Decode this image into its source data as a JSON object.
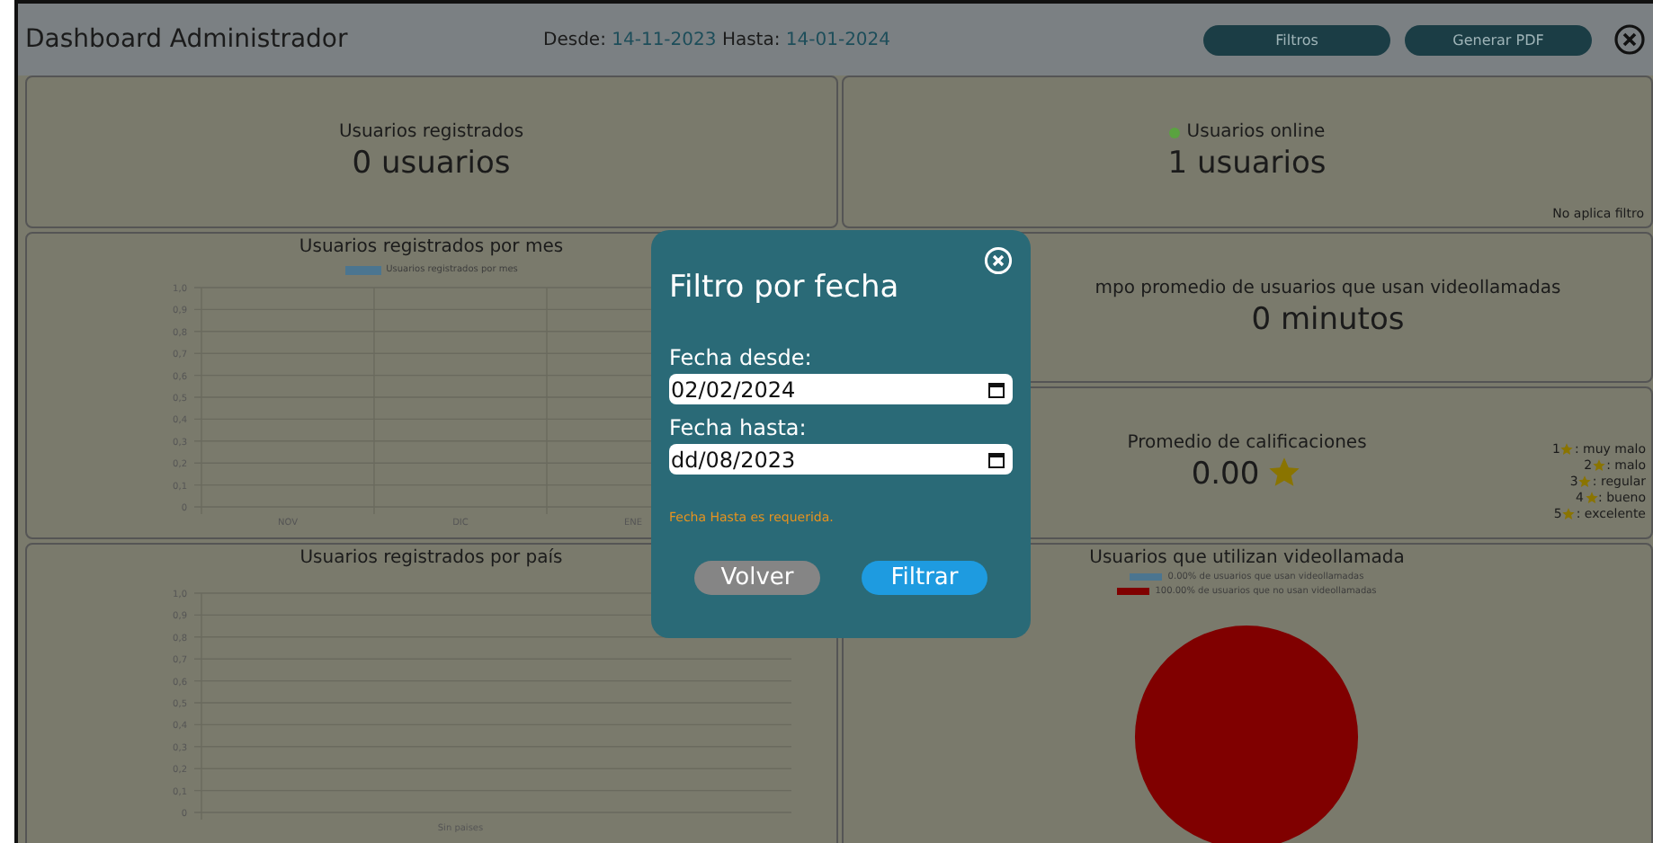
{
  "header": {
    "title": "Dashboard Administrador",
    "from_label": "Desde:",
    "from_date": "14-11-2023",
    "to_label": "Hasta:",
    "to_date": "14-01-2024",
    "buttons": [
      "Filtros",
      "Generar PDF"
    ]
  },
  "cards": {
    "registered": {
      "title": "Usuarios registrados",
      "value": "0 usuarios"
    },
    "online": {
      "title": "Usuarios online",
      "value": "1 usuarios",
      "note": "No aplica filtro"
    },
    "avg_time": {
      "title": "mpo promedio de usuarios que usan videollamadas",
      "value": "0 minutos"
    },
    "rating": {
      "title": "Promedio de calificaciones",
      "value": "0.00",
      "legend": [
        {
          "number": "1",
          "label": ": muy malo"
        },
        {
          "number": "2",
          "label": ": malo"
        },
        {
          "number": "3",
          "label": ": regular"
        },
        {
          "number": "4",
          "label": ": bueno"
        },
        {
          "number": "5",
          "label": ": excelente"
        }
      ]
    }
  },
  "month_chart": {
    "chart_data": {
      "type": "bar",
      "title": "Usuarios registrados por mes",
      "categories": [
        "NOV",
        "DIC",
        "ENE"
      ],
      "grid": true,
      "series": [
        {
          "name": "Usuarios registrados por mes",
          "color": "#4b7590",
          "values": [
            0,
            0,
            0
          ]
        }
      ],
      "ylim": [
        0,
        1
      ],
      "yticks": [
        {
          "value": 0,
          "label": "0"
        },
        {
          "value": 0.1,
          "label": "0,1"
        },
        {
          "value": 0.2,
          "label": "0,2"
        },
        {
          "value": 0.3,
          "label": "0,3"
        },
        {
          "value": 0.4,
          "label": "0,4"
        },
        {
          "value": 0.5,
          "label": "0,5"
        },
        {
          "value": 0.6,
          "label": "0,6"
        },
        {
          "value": 0.7,
          "label": "0,7"
        },
        {
          "value": 0.8,
          "label": "0,8"
        },
        {
          "value": 0.9,
          "label": "0,9"
        },
        {
          "value": 1,
          "label": "1,0"
        }
      ]
    }
  },
  "country_chart": {
    "chart_data": {
      "type": "bar",
      "title": "Usuarios registrados por país",
      "categories": [
        "Sin paises"
      ],
      "series": [
        {
          "values": [
            0
          ]
        }
      ],
      "grid": true,
      "ylim": [
        0,
        1
      ],
      "yticks": [
        {
          "value": 0,
          "label": "0"
        },
        {
          "value": 0.1,
          "label": "0,1"
        },
        {
          "value": 0.2,
          "label": "0,2"
        },
        {
          "value": 0.3,
          "label": "0,3"
        },
        {
          "value": 0.4,
          "label": "0,4"
        },
        {
          "value": 0.5,
          "label": "0,5"
        },
        {
          "value": 0.6,
          "label": "0,6"
        },
        {
          "value": 0.7,
          "label": "0,7"
        },
        {
          "value": 0.8,
          "label": "0,8"
        },
        {
          "value": 0.9,
          "label": "0,9"
        },
        {
          "value": 1,
          "label": "1,0"
        }
      ]
    }
  },
  "video_chart": {
    "chart_data": {
      "type": "pie",
      "title": "Usuarios que utilizan videollamada",
      "categories": [
        "0.00% de usuarios que usan videollamadas",
        "100.00% de usuarios que no usan videollamadas"
      ],
      "colors": [
        "#4b7590",
        "#800000"
      ],
      "values": [
        0,
        100
      ]
    }
  },
  "modal": {
    "title": "Filtro por fecha",
    "from_label": "Fecha desde:",
    "from_value": "02/02/2024",
    "to_label": "Fecha hasta:",
    "to_value": "dd/08/2023",
    "error": "Fecha Hasta es requerida.",
    "back_button": "Volver",
    "filter_button": "Filtrar"
  }
}
